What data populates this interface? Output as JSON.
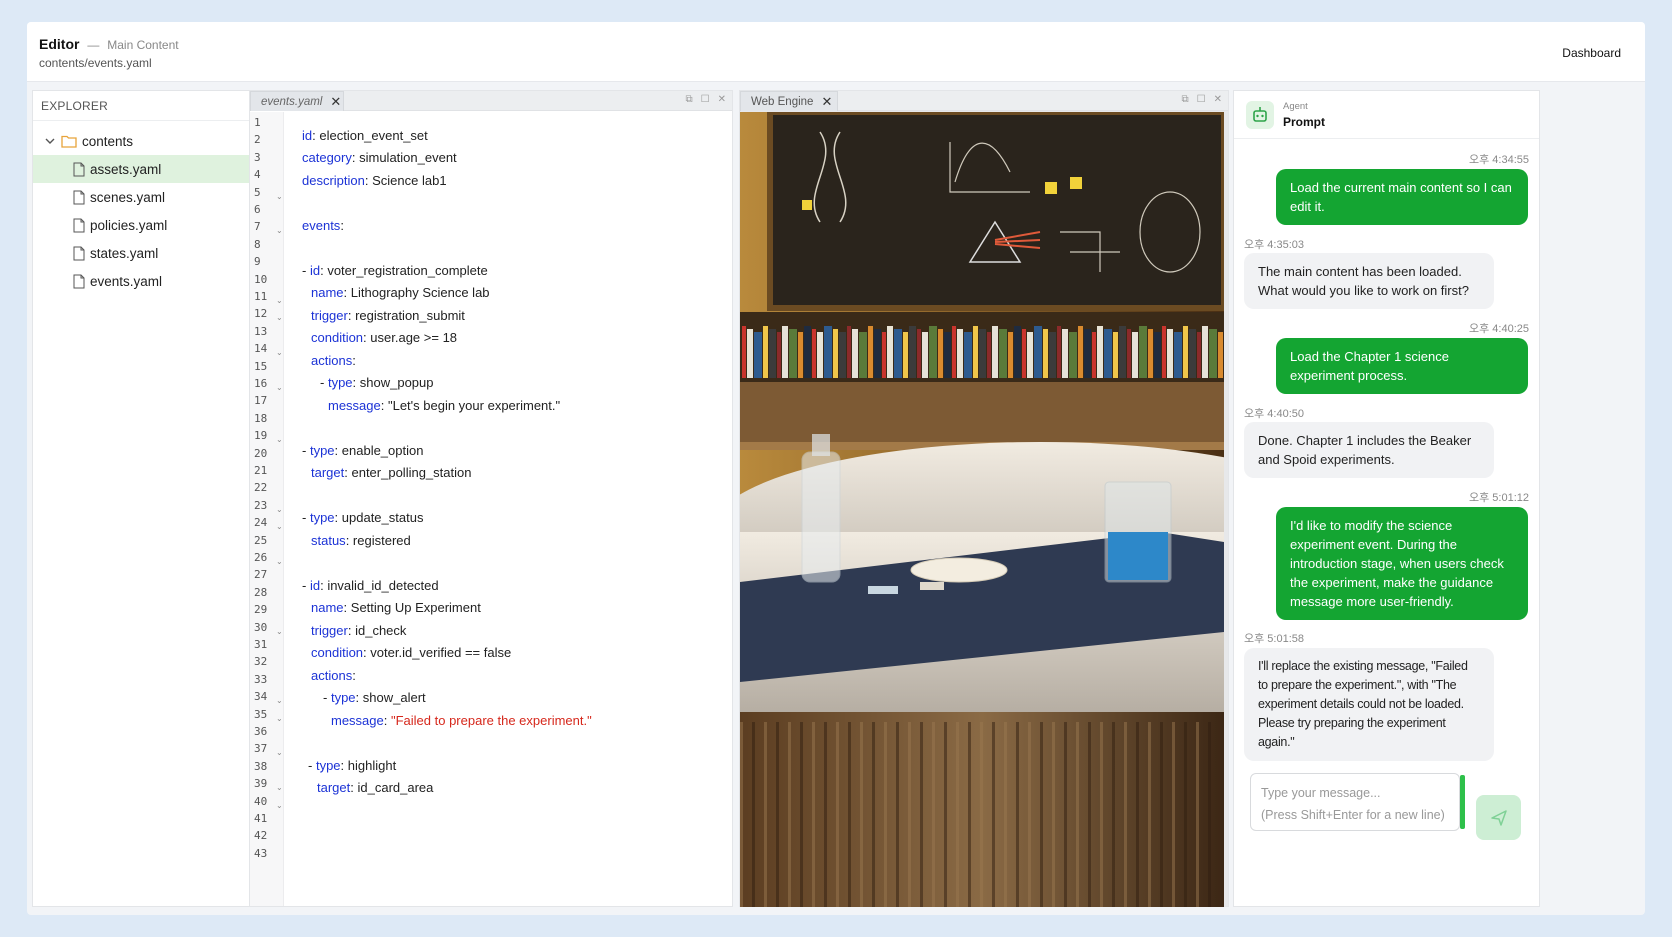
{
  "header": {
    "title": "Editor",
    "separator": "—",
    "subtitle": "Main Content",
    "path": "contents/events.yaml",
    "dashboard_label": "Dashboard"
  },
  "explorer": {
    "title": "EXPLORER",
    "folder": "contents",
    "files": [
      "assets.yaml",
      "scenes.yaml",
      "policies.yaml",
      "states.yaml",
      "events.yaml"
    ],
    "active_file": "assets.yaml"
  },
  "editor": {
    "tab_label": "events.yaml",
    "line_numbers": [
      "1",
      "2",
      "3",
      "4",
      "5",
      "6",
      "7",
      "8",
      "9",
      "10",
      "11",
      "12",
      "13",
      "14",
      "15",
      "16",
      "17",
      "18",
      "19",
      "20",
      "21",
      "22",
      "23",
      "24",
      "25",
      "26",
      "27",
      "28",
      "29",
      "30",
      "31",
      "32",
      "33",
      "34",
      "35",
      "36",
      "37",
      "38",
      "39",
      "40",
      "41",
      "42",
      "43"
    ],
    "code": {
      "l1k": "id",
      "l1v": " election_event_set",
      "l2k": "category",
      "l2v": " simulation_event",
      "l3k": "description",
      "l3v": " Science lab1",
      "l4k": "events",
      "l5p": "- ",
      "l5k": "id",
      "l5v": " voter_registration_complete",
      "l6k": "name",
      "l6v": " Lithography Science lab",
      "l7k": "trigger",
      "l7v": " registration_submit",
      "l8k": "condition",
      "l8v": " user.age >= 18",
      "l9k": "actions",
      "l10p": "- ",
      "l10k": "type",
      "l10v": " show_popup",
      "l11k": "message",
      "l11v": " \"Let's begin your experiment.\"",
      "l12p": "- ",
      "l12k": "type",
      "l12v": " enable_option",
      "l13k": "target",
      "l13v": " enter_polling_station",
      "l14p": "- ",
      "l14k": "type",
      "l14v": " update_status",
      "l15k": "status",
      "l15v": " registered",
      "l16p": "- ",
      "l16k": "id",
      "l16v": " invalid_id_detected",
      "l17k": "name",
      "l17v": " Setting Up Experiment",
      "l18k": "trigger",
      "l18v": " id_check",
      "l19k": "condition",
      "l19v": " voter.id_verified == false",
      "l20k": "actions",
      "l21p": "- ",
      "l21k": "type",
      "l21v": " show_alert",
      "l22k": "message",
      "l22v": "\"Failed to prepare the experiment.\"",
      "l23p": "- ",
      "l23k": "type",
      "l23v": " highlight",
      "l24k": "target",
      "l24v": " id_card_area"
    }
  },
  "web_engine": {
    "tab_label": "Web Engine"
  },
  "chat": {
    "agent_label": "Agent",
    "agent_title": "Prompt",
    "messages": [
      {
        "role": "user",
        "time": "오후 4:34:55",
        "text": "Load the current main content so I can edit it."
      },
      {
        "role": "bot",
        "time": "오후 4:35:03",
        "text": "The main content has been loaded. What would you like to work on first?"
      },
      {
        "role": "user",
        "time": "오후 4:40:25",
        "text": "Load the Chapter 1 science experiment process."
      },
      {
        "role": "bot",
        "time": "오후 4:40:50",
        "text": "Done. Chapter 1 includes the Beaker and Spoid experiments."
      },
      {
        "role": "user",
        "time": "오후 5:01:12",
        "text": "I'd like to modify the science experiment event. During the introduction stage, when users check the experiment, make the guidance message more user-friendly."
      },
      {
        "role": "bot",
        "time": "오후 5:01:58",
        "text": "I'll replace the existing message, \"Failed to prepare the experiment.\", with \"The experiment details could not be loaded. Please try preparing the experiment again.\""
      }
    ],
    "input_placeholder_line1": "Type your message...",
    "input_placeholder_line2": "(Press Shift+Enter for a new line)",
    "colors": {
      "user_bubble": "#14a532",
      "bot_bubble": "#f1f2f4",
      "accent": "#2ec04a"
    }
  }
}
